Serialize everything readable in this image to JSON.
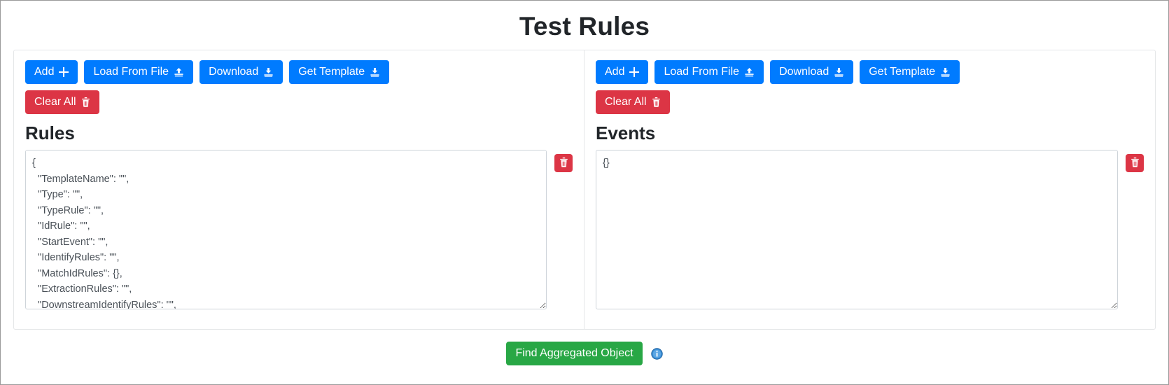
{
  "page": {
    "title": "Test Rules"
  },
  "panels": [
    {
      "id": "rules",
      "section_title": "Rules",
      "toolbar": {
        "add": "Add",
        "load_from_file": "Load From File",
        "download": "Download",
        "get_template": "Get Template",
        "clear_all": "Clear All"
      },
      "icons": {
        "add": "plus-icon",
        "load_from_file": "upload-icon",
        "download": "download-icon",
        "get_template": "download-icon",
        "clear_all": "trash-icon",
        "delete_entry": "trash-icon"
      },
      "editor": {
        "value": "{\n  \"TemplateName\": \"\",\n  \"Type\": \"\",\n  \"TypeRule\": \"\",\n  \"IdRule\": \"\",\n  \"StartEvent\": \"\",\n  \"IdentifyRules\": \"\",\n  \"MatchIdRules\": {},\n  \"ExtractionRules\": \"\",\n  \"DownstreamIdentifyRules\": \"\",\n  \"AggregationRules\": \"\",\n  \"OutputRules\": \"\"\n}",
        "placeholder": "",
        "scrollbar": true
      }
    },
    {
      "id": "events",
      "section_title": "Events",
      "toolbar": {
        "add": "Add",
        "load_from_file": "Load From File",
        "download": "Download",
        "get_template": "Get Template",
        "clear_all": "Clear All"
      },
      "icons": {
        "add": "plus-icon",
        "load_from_file": "upload-icon",
        "download": "download-icon",
        "get_template": "download-icon",
        "clear_all": "trash-icon",
        "delete_entry": "trash-icon"
      },
      "editor": {
        "value": "{}",
        "placeholder": "",
        "scrollbar": false
      }
    }
  ],
  "footer": {
    "find_button": "Find Aggregated Object",
    "info_icon": "info-circle-icon"
  },
  "colors": {
    "primary": "#007bff",
    "danger": "#dc3545",
    "success": "#28a745",
    "info": "#2e86de",
    "text": "#212529",
    "editor_text": "#495057",
    "border": "#ced4da"
  }
}
